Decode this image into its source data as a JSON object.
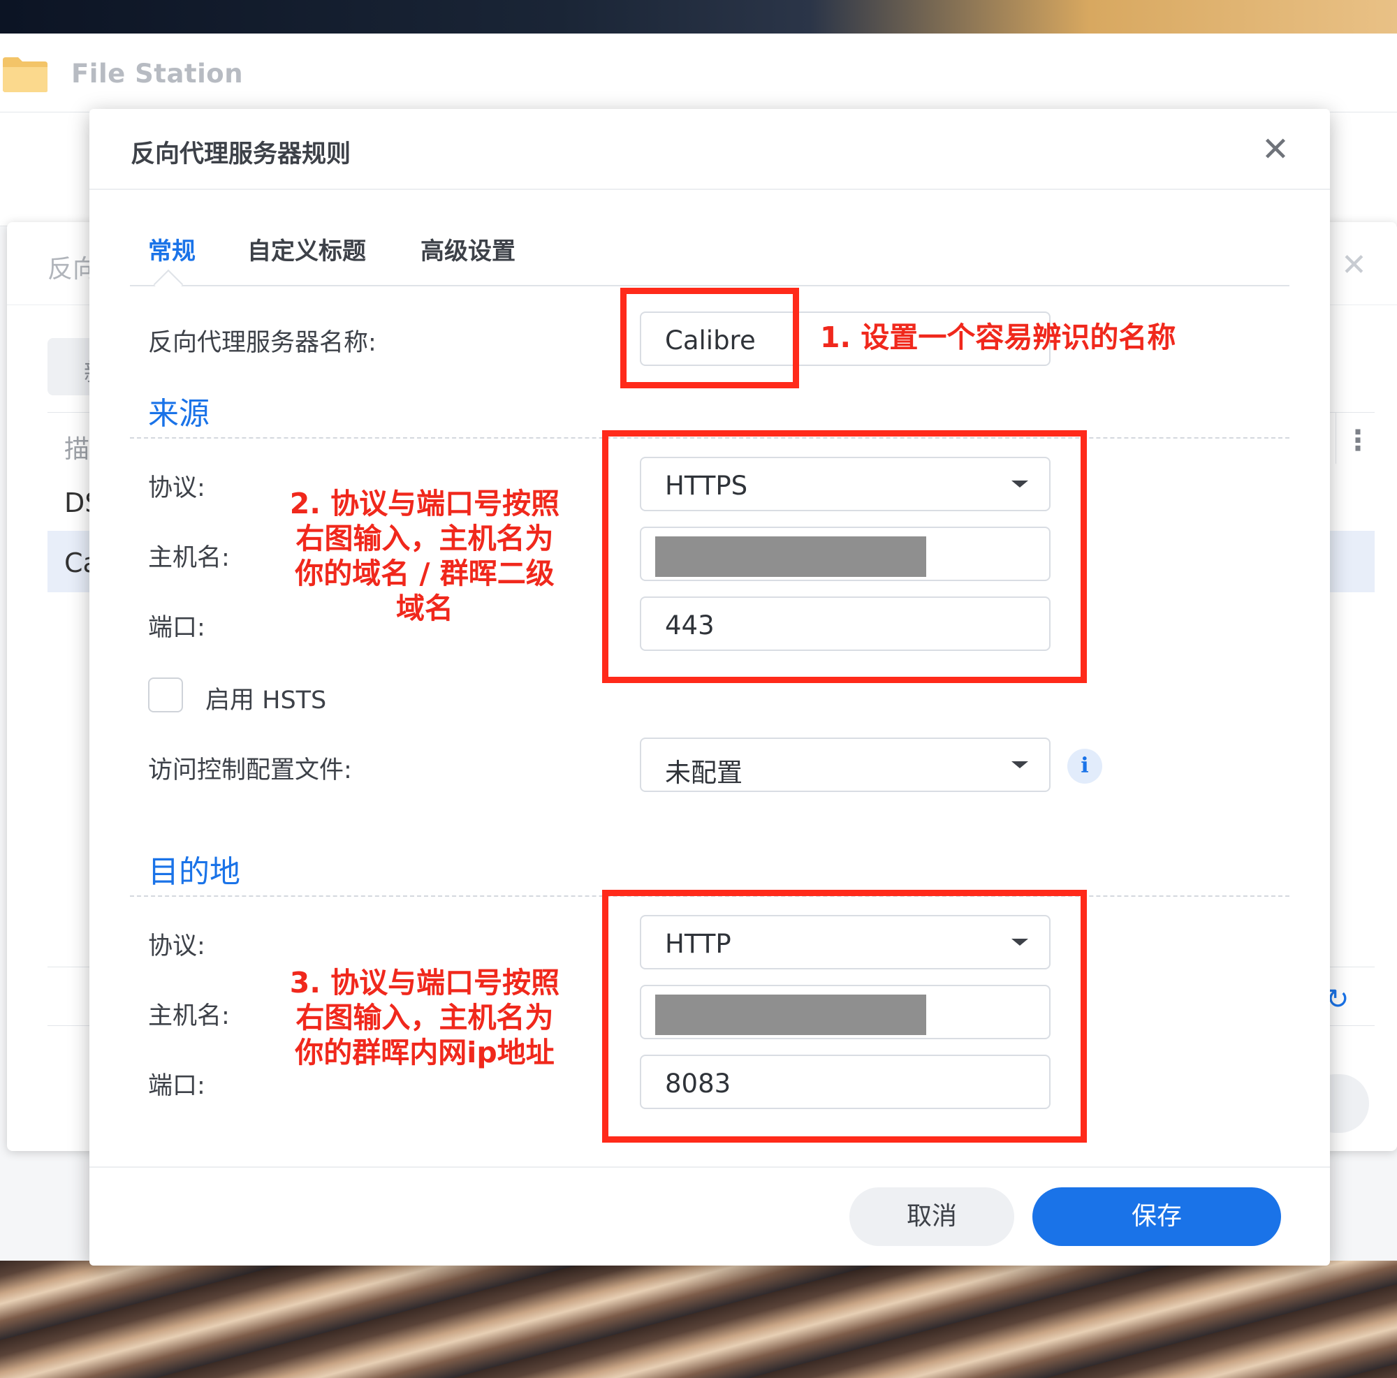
{
  "file_station": {
    "title": "File Station"
  },
  "background_panel": {
    "title_partial": "反向",
    "close_symbol": "✕",
    "new_button_partial": "新",
    "column_desc_partial": "描",
    "more_symbol": "⋮",
    "rows": [
      "DS",
      "Ca"
    ],
    "refresh_symbol": "↻"
  },
  "dialog": {
    "title": "反向代理服务器规则",
    "close_symbol": "✕",
    "tabs": [
      {
        "label": "常规",
        "active": true
      },
      {
        "label": "自定义标题",
        "active": false
      },
      {
        "label": "高级设置",
        "active": false
      }
    ],
    "name_label": "反向代理服务器名称:",
    "name_value": "Calibre",
    "source": {
      "heading": "来源",
      "protocol_label": "协议:",
      "protocol_value": "HTTPS",
      "hostname_label": "主机名:",
      "hostname_value": "",
      "port_label": "端口:",
      "port_value": "443",
      "hsts_label": "启用 HSTS",
      "hsts_checked": false,
      "access_label": "访问控制配置文件:",
      "access_value": "未配置",
      "info_symbol": "i"
    },
    "destination": {
      "heading": "目的地",
      "protocol_label": "协议:",
      "protocol_value": "HTTP",
      "hostname_label": "主机名:",
      "hostname_value": "",
      "port_label": "端口:",
      "port_value": "8083"
    },
    "buttons": {
      "cancel": "取消",
      "save": "保存"
    }
  },
  "annotations": {
    "note1": "1. 设置一个容易辨识的名称",
    "note2_lines": [
      "2. 协议与端口号按照",
      "右图输入，主机名为",
      "你的域名 / 群晖二级",
      "域名"
    ],
    "note3_lines": [
      "3. 协议与端口号按照",
      "右图输入，主机名为",
      "你的群晖内网ip地址"
    ],
    "color": "#ff2a1a"
  },
  "colors": {
    "accent": "#1a73e8",
    "annotation": "#ff2a1a"
  }
}
